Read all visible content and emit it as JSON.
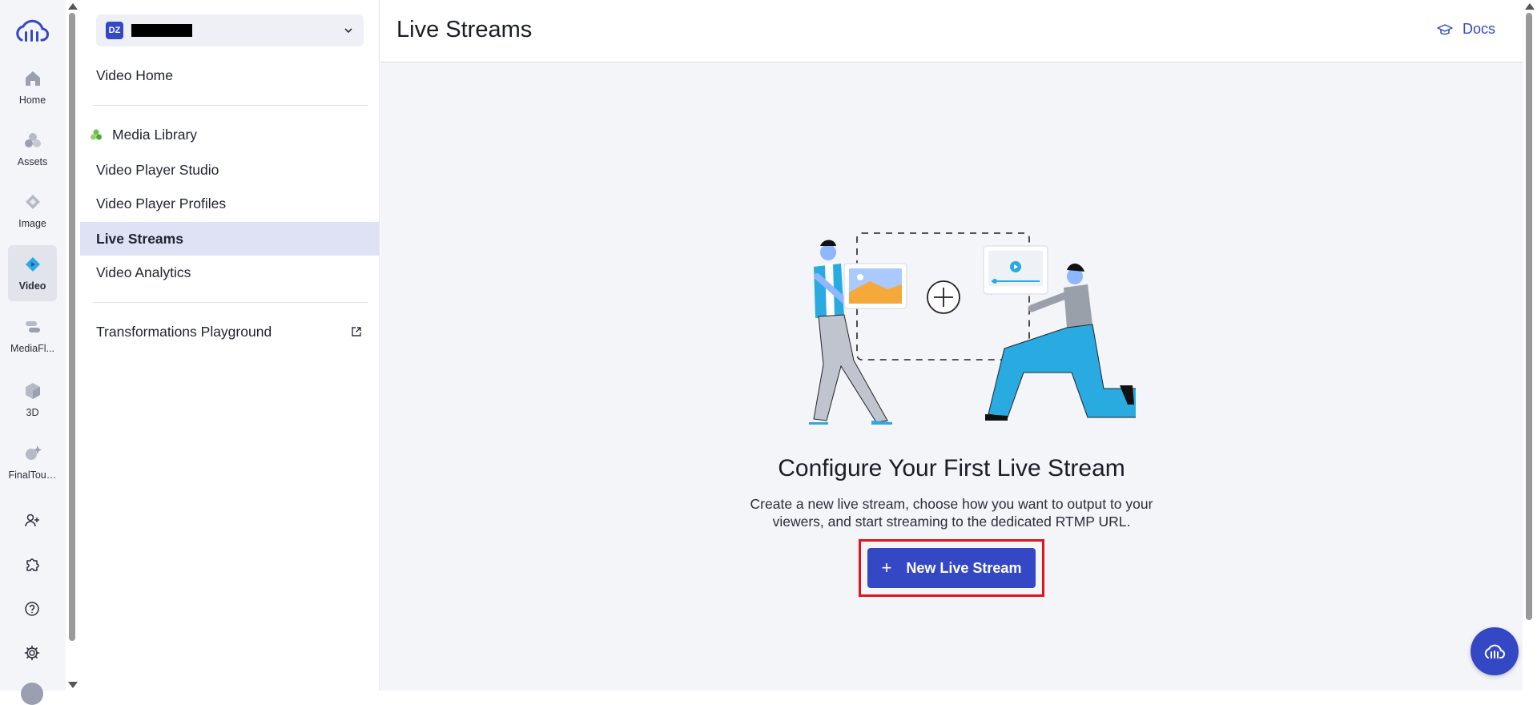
{
  "rail": {
    "items": [
      {
        "label": "Home",
        "icon": "home-icon",
        "active": false
      },
      {
        "label": "Assets",
        "icon": "assets-icon",
        "active": false
      },
      {
        "label": "Image",
        "icon": "image-icon",
        "active": false
      },
      {
        "label": "Video",
        "icon": "video-icon",
        "active": true
      },
      {
        "label": "MediaFl...",
        "icon": "mediaflows-icon",
        "active": false
      },
      {
        "label": "3D",
        "icon": "cube-icon",
        "active": false
      },
      {
        "label": "FinalTouch",
        "icon": "sparkle-icon",
        "active": false
      }
    ],
    "utilities": [
      "add-user-icon",
      "puzzle-icon",
      "help-icon",
      "settings-icon"
    ]
  },
  "sidebar": {
    "environment": {
      "badge": "DZ",
      "name_redacted": true
    },
    "items": [
      {
        "label": "Video Home",
        "active": false
      },
      {
        "label": "Media Library",
        "active": false,
        "icon": "media-library-icon"
      },
      {
        "label": "Video Player Studio",
        "active": false
      },
      {
        "label": "Video Player Profiles",
        "active": false
      },
      {
        "label": "Live Streams",
        "active": true
      },
      {
        "label": "Video Analytics",
        "active": false
      },
      {
        "label": "Transformations Playground",
        "active": false,
        "external": true
      }
    ]
  },
  "header": {
    "title": "Live Streams",
    "docs_label": "Docs"
  },
  "empty_state": {
    "title": "Configure Your First Live Stream",
    "description": "Create a new live stream, choose how you want to output to your viewers, and start streaming to the dedicated RTMP URL.",
    "button_icon": "+",
    "button_label": "New Live Stream"
  },
  "colors": {
    "accent": "#3448c5",
    "active_nav": "#dfe1f4",
    "highlight_border": "#e0131d",
    "illustration_blue": "#29abe2"
  }
}
